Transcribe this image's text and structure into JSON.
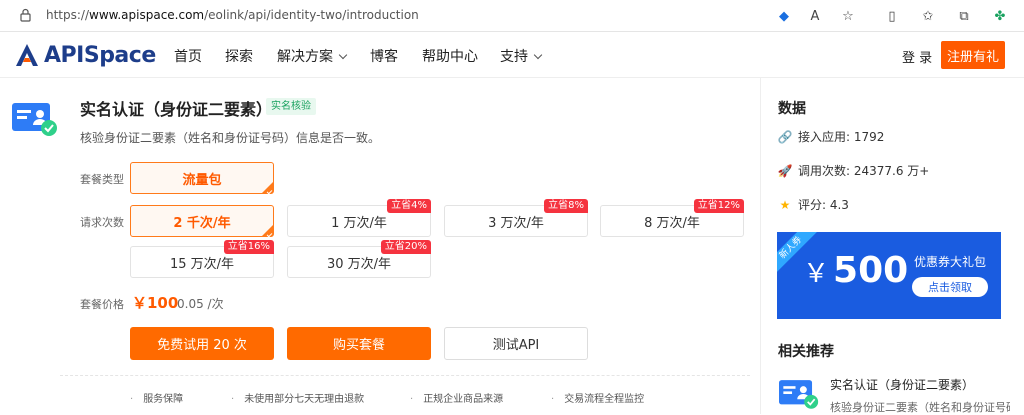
{
  "browser": {
    "url_prefix": "https://",
    "url_host": "www.apispace.com",
    "url_path": "/eolink/api/identity-two/introduction"
  },
  "header": {
    "logo_a": "API",
    "logo_b": "Space",
    "nav": [
      {
        "label": "首页",
        "has_dropdown": false
      },
      {
        "label": "探索",
        "has_dropdown": false
      },
      {
        "label": "解决方案",
        "has_dropdown": true
      },
      {
        "label": "博客",
        "has_dropdown": false
      },
      {
        "label": "帮助中心",
        "has_dropdown": false
      },
      {
        "label": "支持",
        "has_dropdown": true
      }
    ],
    "login_label": "登 录",
    "register_label": "注册有礼"
  },
  "product": {
    "title": "实名认证（身份证二要素）",
    "tag": "实名核验",
    "description": "核验身份证二要素（姓名和身份证号码）信息是否一致。",
    "package_type_label": "套餐类型",
    "package_type_option": "流量包",
    "request_count_label": "请求次数",
    "request_options": [
      {
        "label": "2 千次/年",
        "discount": "",
        "selected": true
      },
      {
        "label": "1 万次/年",
        "discount": "立省4%",
        "selected": false
      },
      {
        "label": "3 万次/年",
        "discount": "立省8%",
        "selected": false
      },
      {
        "label": "8 万次/年",
        "discount": "立省12%",
        "selected": false
      },
      {
        "label": "15 万次/年",
        "discount": "立省16%",
        "selected": false
      },
      {
        "label": "30 万次/年",
        "discount": "立省20%",
        "selected": false
      }
    ],
    "price_label": "套餐价格",
    "price": "￥100",
    "unit_price": "0.05 /次",
    "buttons": {
      "trial": "免费试用 20 次",
      "buy": "购买套餐",
      "test": "测试API"
    },
    "guarantees": [
      "服务保障",
      "未使用部分七天无理由退款",
      "正规企业商品来源",
      "交易流程全程监控"
    ]
  },
  "sidebar": {
    "data_title": "数据",
    "stats": [
      {
        "icon": "link-icon",
        "label": "接入应用: 1792"
      },
      {
        "icon": "rocket-icon",
        "label": "调用次数: 24377.6 万+"
      },
      {
        "icon": "star-icon",
        "label": "评分: 4.3"
      }
    ],
    "coupon": {
      "ribbon": "新人券",
      "currency": "￥",
      "amount": "500",
      "name": "优惠券大礼包",
      "button": "点击领取"
    },
    "related_title": "相关推荐",
    "related": {
      "title": "实名认证（身份证二要素）",
      "description": "核验身份证二要素（姓名和身份证号码）信息是否一致。"
    }
  },
  "colors": {
    "accent": "#ff5a00",
    "brand_blue": "#1d3d8a",
    "coupon_blue": "#1a5ce0",
    "discount_red": "#f5333f"
  }
}
